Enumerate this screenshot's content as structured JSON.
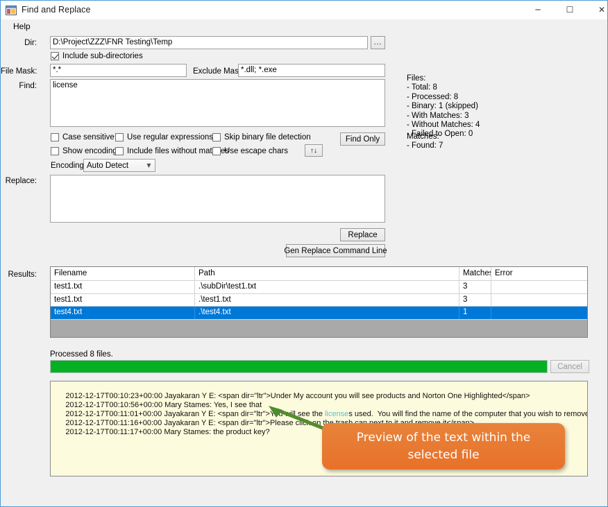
{
  "window": {
    "title": "Find and Replace",
    "icon": "app-form-icon",
    "controls": {
      "minimize": "─",
      "maximize": "☐",
      "close": "✕"
    }
  },
  "menu": {
    "items": [
      {
        "label": "Help"
      }
    ]
  },
  "form": {
    "dir": {
      "label": "Dir:",
      "value": "D:\\Project\\ZZZ\\FNR Testing\\Temp",
      "browse_label": "..."
    },
    "include_subdirs": {
      "label": "Include sub-directories",
      "checked": true
    },
    "file_mask": {
      "label": "File Mask:",
      "value": "*.*"
    },
    "exclude_mask": {
      "label": "Exclude Mask:",
      "value": "*.dll; *.exe"
    },
    "find": {
      "label": "Find:",
      "value": "license"
    },
    "replace": {
      "label": "Replace:",
      "value": ""
    },
    "options": [
      {
        "label": "Case sensitive",
        "checked": false
      },
      {
        "label": "Use regular expressions",
        "checked": false
      },
      {
        "label": "Skip binary file detection",
        "checked": false
      },
      {
        "label": "Show encoding",
        "checked": false
      },
      {
        "label": "Include files without matches",
        "checked": false
      },
      {
        "label": "Use escape chars",
        "checked": false
      }
    ],
    "encoding": {
      "label": "Encoding:",
      "value": "Auto Detect"
    },
    "swap_button_label": "↑↓"
  },
  "buttons": {
    "find_only": "Find Only",
    "replace": "Replace",
    "gen_replace_command_line": "Gen Replace Command Line",
    "cancel": "Cancel"
  },
  "stats": {
    "files_block": "Files:\n- Total: 8\n- Processed: 8\n- Binary: 1 (skipped)\n- With Matches: 3\n- Without Matches: 4\n- Failed to Open: 0",
    "matches_block": "Matches:\n- Found: 7"
  },
  "results": {
    "label": "Results:",
    "columns": [
      "Filename",
      "Path",
      "Matches",
      "Error"
    ],
    "rows": [
      {
        "filename": "test1.txt",
        "path": ".\\subDir\\test1.txt",
        "matches": "3",
        "error": "",
        "selected": false
      },
      {
        "filename": "test1.txt",
        "path": ".\\test1.txt",
        "matches": "3",
        "error": "",
        "selected": false
      },
      {
        "filename": "test4.txt",
        "path": ".\\test4.txt",
        "matches": "1",
        "error": "",
        "selected": true
      }
    ]
  },
  "progress": {
    "status_text": "Processed 8 files.",
    "percent": 100,
    "fill_color": "#06b025"
  },
  "preview": {
    "lines": [
      {
        "pre": "2012-12-17T00:10:23+00:00 Jayakaran Y E: <span dir=\"ltr\">Under My account you will see products and Norton One Highlighted</span>",
        "match": "",
        "post": ""
      },
      {
        "pre": "2012-12-17T00:10:56+00:00 Mary Stames: Yes, I see that",
        "match": "",
        "post": ""
      },
      {
        "pre": "2012-12-17T00:11:01+00:00 Jayakaran Y E: <span dir=\"ltr\">You will see the ",
        "match": "license",
        "post": "s used.  You will find the name of the computer that you wish to remove</span>"
      },
      {
        "pre": "2012-12-17T00:11:16+00:00 Jayakaran Y E: <span dir=\"ltr\">Please click on the trash can next to it and remove it</span>",
        "match": "",
        "post": ""
      },
      {
        "pre": "2012-12-17T00:11:17+00:00 Mary Stames: the product key?",
        "match": "",
        "post": ""
      }
    ]
  },
  "annotation": {
    "callout_text": "Preview of the text within the selected file",
    "callout_color": "#e8752c",
    "arrow_color": "#558b2f"
  }
}
